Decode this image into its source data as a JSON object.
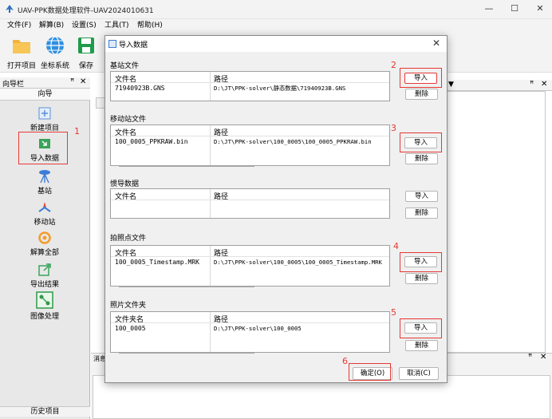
{
  "window": {
    "title": "UAV-PPK数据处理软件-UAV2024010631",
    "minimize": "—",
    "maximize": "☐",
    "close": "✕"
  },
  "menu": [
    "文件(F)",
    "解算(B)",
    "设置(S)",
    "工具(T)",
    "帮助(H)"
  ],
  "toolbar": [
    {
      "label": "打开项目",
      "icon": "folder-icon"
    },
    {
      "label": "坐标系统",
      "icon": "globe-icon"
    },
    {
      "label": "保存",
      "icon": "save-icon"
    }
  ],
  "nav": {
    "title": "向导栏",
    "pin": "ꟸ",
    "close": "✕",
    "tab": "向导",
    "items": [
      {
        "label": "新建项目",
        "icon": "new-project-icon"
      },
      {
        "label": "导入数据",
        "icon": "import-data-icon"
      },
      {
        "label": "基站",
        "icon": "base-station-icon"
      },
      {
        "label": "移动站",
        "icon": "rover-icon"
      },
      {
        "label": "解算全部",
        "icon": "solve-all-icon"
      },
      {
        "label": "导出结果",
        "icon": "export-icon"
      },
      {
        "label": "图像处理",
        "icon": "image-processing-icon"
      }
    ],
    "bottom_tab": "历史项目"
  },
  "workarea": {
    "pin": "ꟸ",
    "close": "✕",
    "message_label": "消息"
  },
  "dialog": {
    "title": "导入数据",
    "close": "✕",
    "sections": [
      {
        "title": "基站文件",
        "col1": "文件名",
        "col2": "路径",
        "file": "71940923B.GNS",
        "path": "D:\\JT\\PPK-solver\\静态数据\\71940923B.GNS",
        "import": "导入",
        "delete": "删除",
        "annotation": "2"
      },
      {
        "title": "移动站文件",
        "col1": "文件名",
        "col2": "路径",
        "file": "100_0005_PPKRAW.bin",
        "path": "D:\\JT\\PPK-solver\\100_0005\\100_0005_PPKRAW.bin",
        "import": "导入",
        "delete": "删除",
        "annotation": "3"
      },
      {
        "title": "惯导数据",
        "col1": "文件名",
        "col2": "路径",
        "file": "",
        "path": "",
        "import": "导入",
        "delete": "删除",
        "annotation": ""
      },
      {
        "title": "拍照点文件",
        "col1": "文件名",
        "col2": "路径",
        "file": "100_0005_Timestamp.MRK",
        "path": "D:\\JT\\PPK-solver\\100_0005\\100_0005_Timestamp.MRK",
        "import": "导入",
        "delete": "删除",
        "annotation": "4"
      },
      {
        "title": "照片文件夹",
        "col1": "文件夹名",
        "col2": "路径",
        "file": "100_0005",
        "path": "D:\\JT\\PPK-solver\\100_0005",
        "import": "导入",
        "delete": "删除",
        "annotation": "5"
      }
    ],
    "ok": "确定(O)",
    "cancel": "取消(C)",
    "ok_annotation": "6"
  },
  "nav_annotation": "1",
  "colors": {
    "annotation": "#e53935",
    "accent": "#3a7bd5"
  }
}
